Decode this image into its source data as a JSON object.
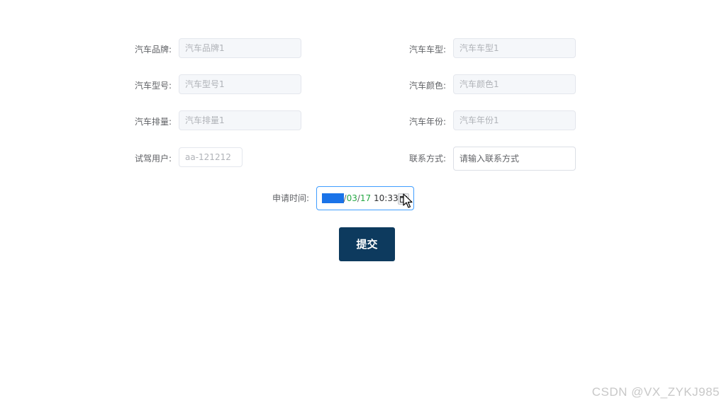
{
  "form": {
    "brand": {
      "label": "汽车品牌:",
      "placeholder": "汽车品牌1"
    },
    "car_type": {
      "label": "汽车车型:",
      "placeholder": "汽车车型1"
    },
    "model": {
      "label": "汽车型号:",
      "placeholder": "汽车型号1"
    },
    "color": {
      "label": "汽车颜色:",
      "placeholder": "汽车颜色1"
    },
    "displacement": {
      "label": "汽车排量:",
      "placeholder": "汽车排量1"
    },
    "year": {
      "label": "汽车年份:",
      "placeholder": "汽车年份1"
    },
    "user": {
      "label": "试驾用户:",
      "value": "aa-121212"
    },
    "contact": {
      "label": "联系方式:",
      "placeholder": "请输入联系方式"
    },
    "apply_time": {
      "label": "申请时间:",
      "year": "2023",
      "sep1": "/",
      "month": "03",
      "sep2": "/",
      "day": "17",
      "time": "10:33"
    },
    "submit_label": "提交"
  },
  "icons": {
    "calendar": "calendar-icon",
    "cursor": "mouse-pointer-icon"
  },
  "colors": {
    "submit_bg": "#0d3a5e",
    "focus_border": "#409eff",
    "selected_year_bg": "#1a73e8",
    "date_part": "#25a844"
  },
  "watermark": "CSDN @VX_ZYKJ985"
}
